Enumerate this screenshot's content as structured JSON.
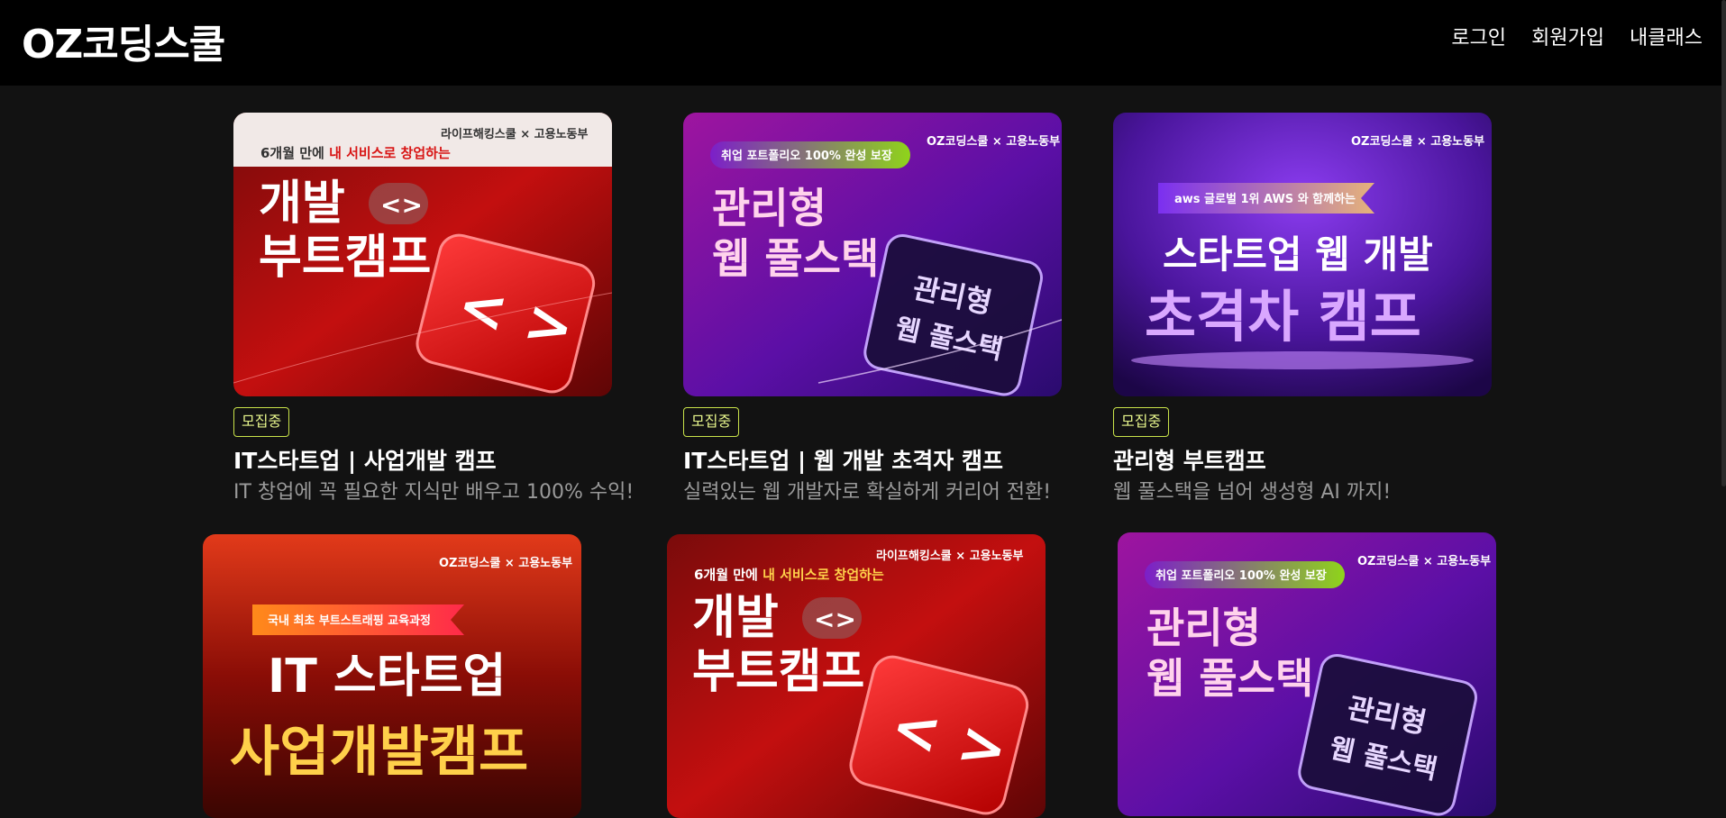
{
  "header": {
    "logo": "OZ코딩스쿨",
    "nav": [
      "로그인",
      "회원가입",
      "내클래스"
    ]
  },
  "cards": [
    {
      "badge": "모집중",
      "title": "IT스타트업 | 사업개발 캠프",
      "desc": "IT 창업에 꼭 필요한 지식만 배우고 100% 수익!",
      "thumb": {
        "theme": "red",
        "partners": "라이프해킹스쿨 × 고용노동부",
        "tagline_prefix": "6개월 만에 ",
        "tagline_highlight": "내 서비스로 창업하는",
        "line1": "개발",
        "line2": "부트캠프",
        "icon": "code-brackets-icon"
      }
    },
    {
      "badge": "모집중",
      "title": "IT스타트업 | 웹 개발 초격자 캠프",
      "desc": "실력있는 웹 개발자로 확실하게 커리어 전환!",
      "thumb": {
        "theme": "purple",
        "partners": "OZ코딩스쿨 × 고용노동부",
        "pill": "취업 포트폴리오 100% 완성 보장",
        "line1": "관리형",
        "line2": "웹 풀스택",
        "card_line1": "관리형",
        "card_line2": "웹 풀스택"
      }
    },
    {
      "badge": "모집중",
      "title": "관리형 부트캠프",
      "desc": "웹 풀스택을 넘어 생성형 AI 까지!",
      "thumb": {
        "theme": "violet",
        "partners": "OZ코딩스쿨 × 고용노동부",
        "ribbon": "aws 글로벌 1위 AWS 와 함께하는",
        "line1": "스타트업 웹 개발",
        "line2": "초격차 캠프"
      }
    },
    {
      "thumb": {
        "theme": "fire",
        "partners": "OZ코딩스쿨 × 고용노동부",
        "ribbon": "국내 최초 부트스트래핑 교육과정",
        "line1": "IT 스타트업",
        "line2": "사업개발캠프"
      }
    },
    {
      "thumb": {
        "theme": "red",
        "partners": "라이프해킹스쿨 × 고용노동부",
        "tagline_prefix": "6개월 만에 ",
        "tagline_highlight": "내 서비스로 창업하는",
        "line1": "개발",
        "line2": "부트캠프",
        "icon": "code-brackets-icon"
      }
    },
    {
      "thumb": {
        "theme": "purple",
        "partners": "OZ코딩스쿨 × 고용노동부",
        "pill": "취업 포트폴리오 100% 완성 보장",
        "line1": "관리형",
        "line2": "웹 풀스택",
        "card_line1": "관리형",
        "card_line2": "웹 풀스택"
      }
    }
  ]
}
